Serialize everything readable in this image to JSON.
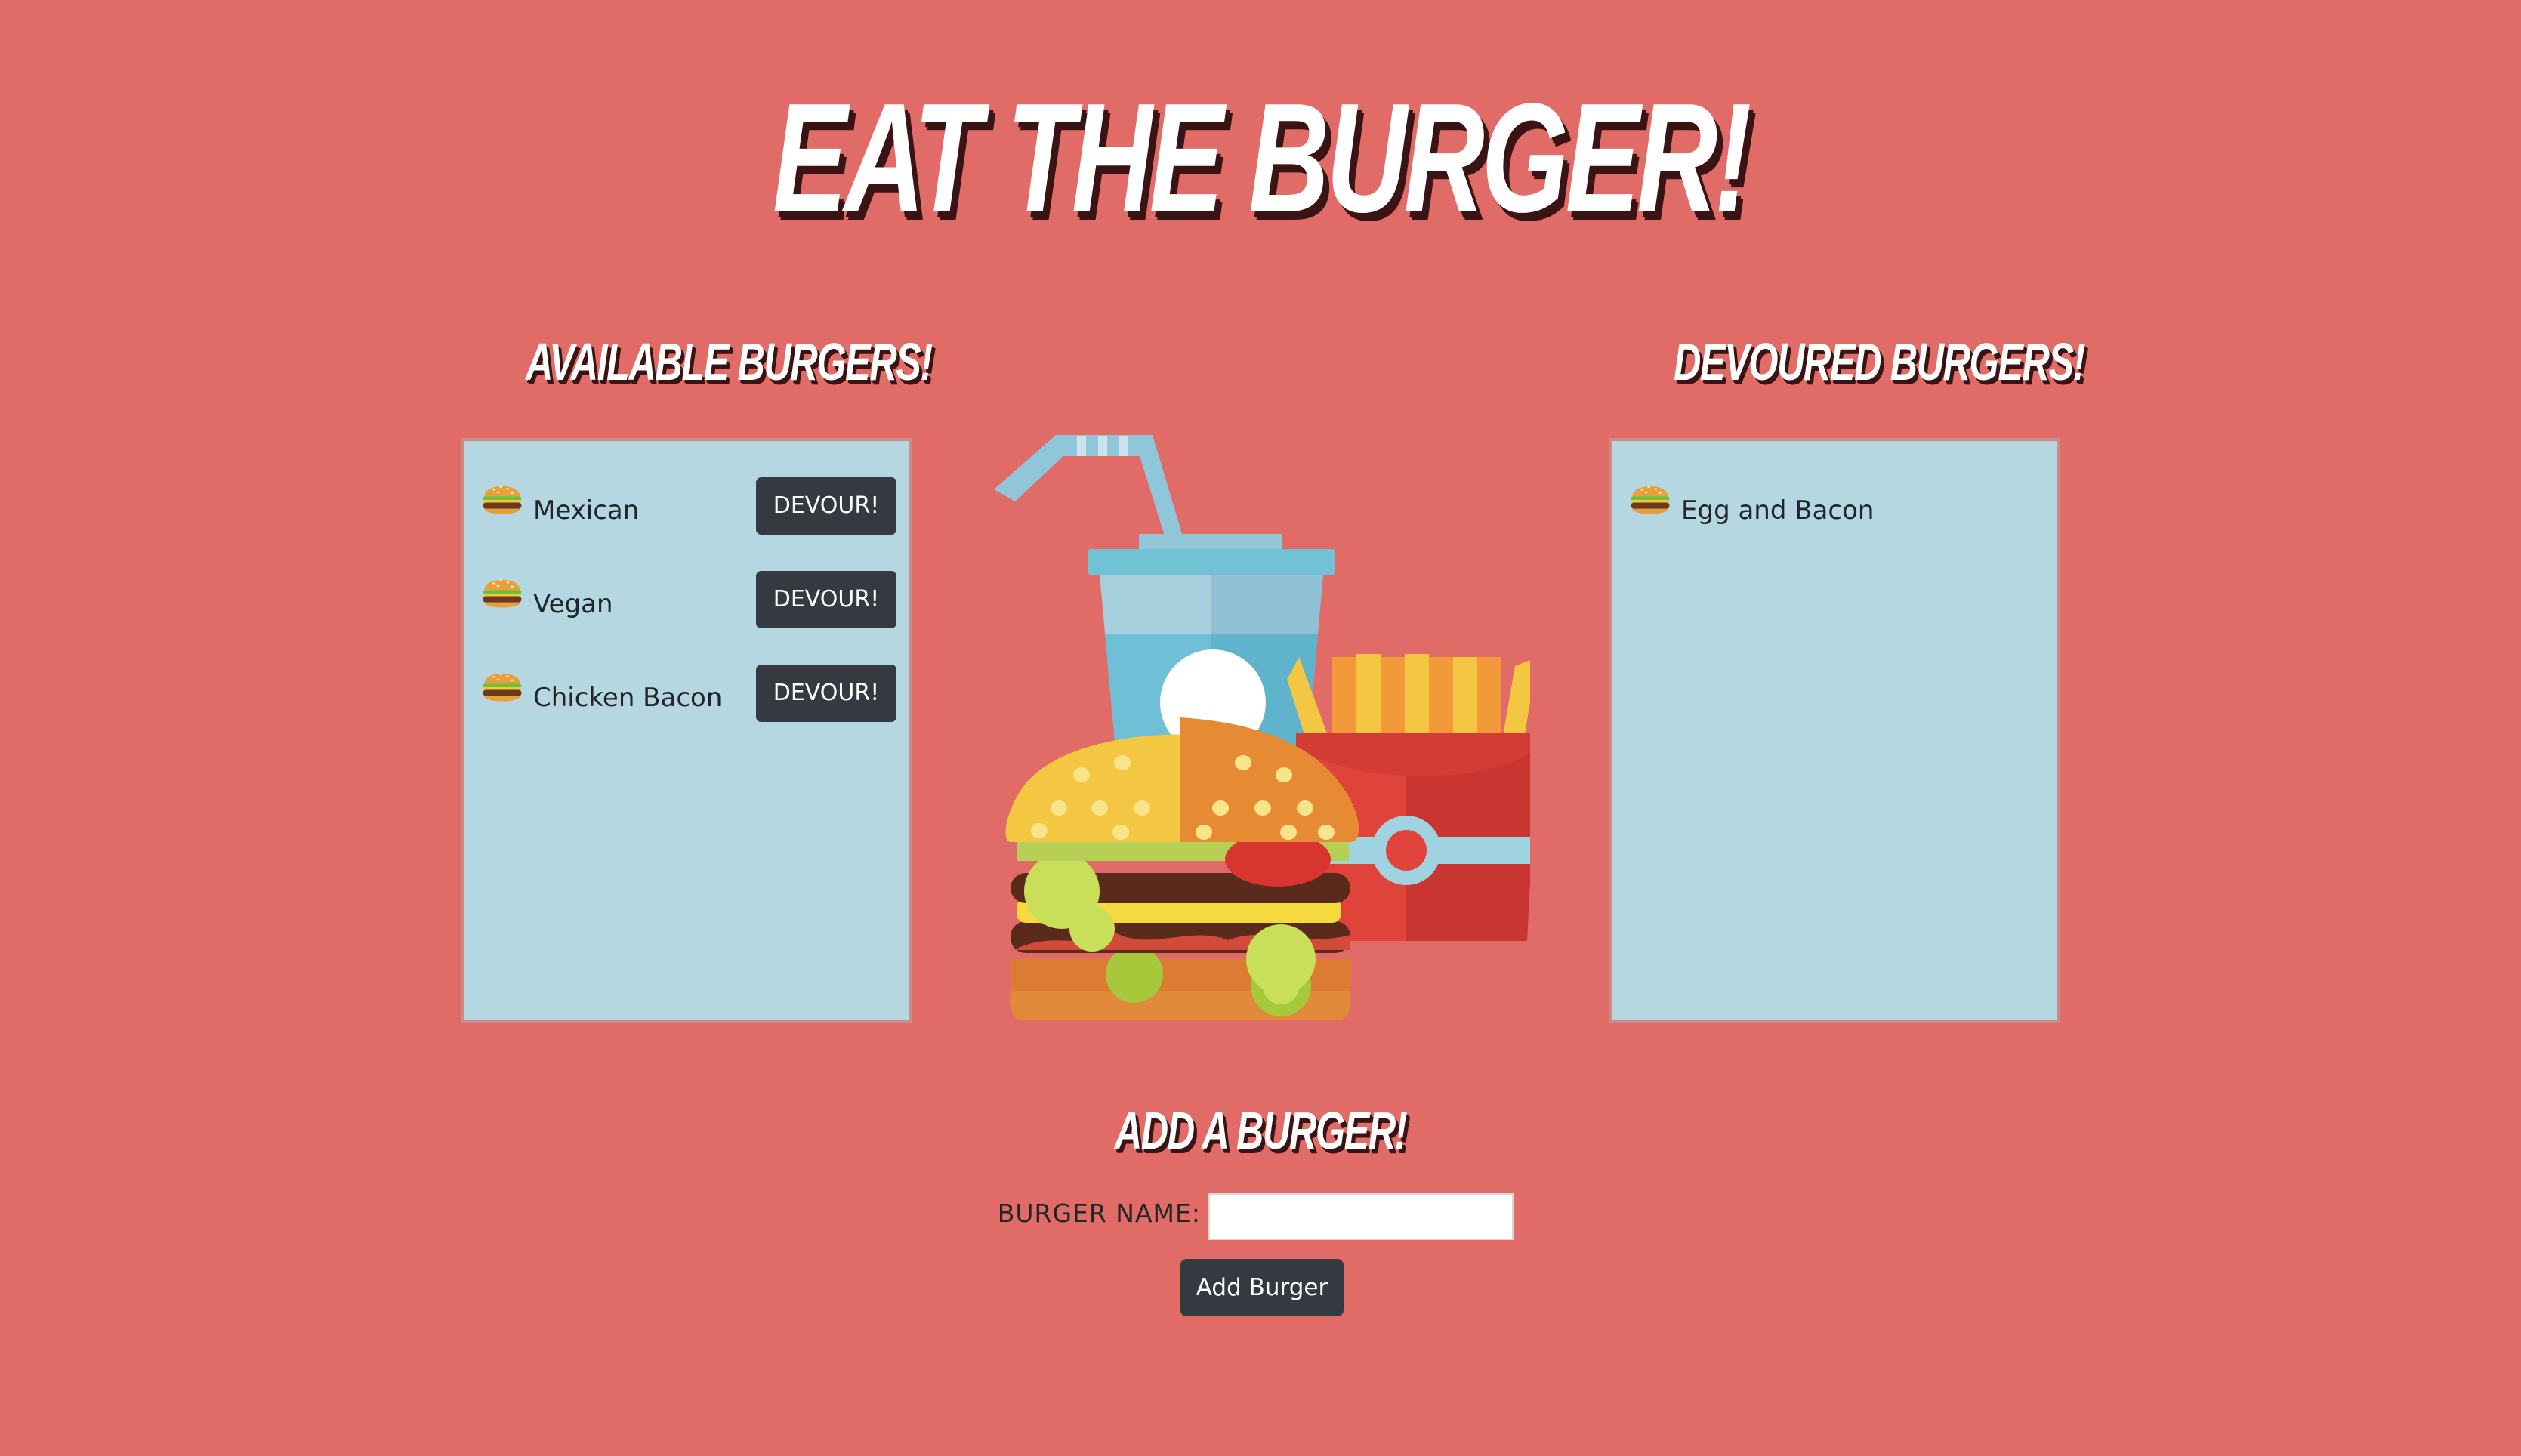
{
  "page": {
    "title": "Eat the Burger!",
    "background_color": "#e06b67"
  },
  "available": {
    "title": "Available Burgers!",
    "items": [
      {
        "name": "Mexican",
        "icon": "burger-icon",
        "button_label": "DEVOUR!"
      },
      {
        "name": "Vegan",
        "icon": "burger-icon",
        "button_label": "DEVOUR!"
      },
      {
        "name": "Chicken Bacon",
        "icon": "burger-icon",
        "button_label": "DEVOUR!"
      }
    ]
  },
  "devoured": {
    "title": "Devoured Burgers!",
    "items": [
      {
        "name": "Egg and Bacon",
        "icon": "burger-icon"
      }
    ]
  },
  "illustration": {
    "icon": "burger-drink-fries-illustration"
  },
  "add_form": {
    "title": "Add a Burger!",
    "label": "BURGER NAME:",
    "input_value": "",
    "input_placeholder": "",
    "submit_label": "Add Burger"
  },
  "colors": {
    "panel": "#b4d7e2",
    "button": "#343a40",
    "title_text": "#ffffff",
    "title_shadow": "#3a1414"
  }
}
